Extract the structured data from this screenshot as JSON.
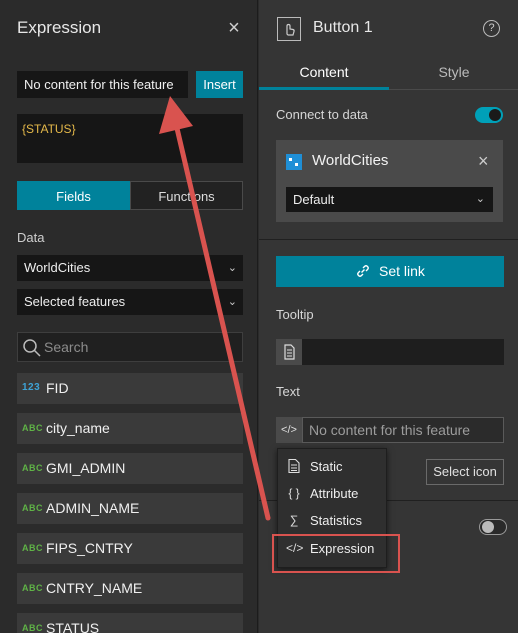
{
  "left_panel": {
    "title": "Expression",
    "expression_preview": "No content for this feature",
    "insert_label": "Insert",
    "expression_text": "{STATUS}",
    "tabs": [
      {
        "label": "Fields",
        "active": true
      },
      {
        "label": "Functions",
        "active": false
      }
    ],
    "data_label": "Data",
    "data_source": "WorldCities",
    "feature_scope": "Selected features",
    "search_placeholder": "Search",
    "fields": [
      {
        "type": "123",
        "name": "FID"
      },
      {
        "type": "ABC",
        "name": "city_name"
      },
      {
        "type": "ABC",
        "name": "GMI_ADMIN"
      },
      {
        "type": "ABC",
        "name": "ADMIN_NAME"
      },
      {
        "type": "ABC",
        "name": "FIPS_CNTRY"
      },
      {
        "type": "ABC",
        "name": "CNTRY_NAME"
      },
      {
        "type": "ABC",
        "name": "STATUS"
      }
    ]
  },
  "right_panel": {
    "title": "Button 1",
    "tabs": [
      {
        "label": "Content",
        "active": true
      },
      {
        "label": "Style",
        "active": false
      }
    ],
    "connect_label": "Connect to data",
    "connect_enabled": true,
    "data_source": {
      "name": "WorldCities",
      "view": "Default"
    },
    "set_link_label": "Set link",
    "tooltip_label": "Tooltip",
    "text_label": "Text",
    "text_value": "No content for this feature",
    "select_icon_label": "Select icon",
    "bottom_toggle_enabled": false
  },
  "text_menu": {
    "items": [
      {
        "icon": "document-icon",
        "label": "Static"
      },
      {
        "icon": "braces-icon",
        "label": "Attribute"
      },
      {
        "icon": "sigma-icon",
        "label": "Statistics"
      },
      {
        "icon": "code-icon",
        "label": "Expression"
      }
    ],
    "highlighted": "Expression"
  },
  "colors": {
    "accent": "#00829b",
    "annotation": "#d9534f",
    "number_type": "#3ea3d6",
    "string_type": "#5fb246",
    "expression_text": "#e5b94a"
  }
}
